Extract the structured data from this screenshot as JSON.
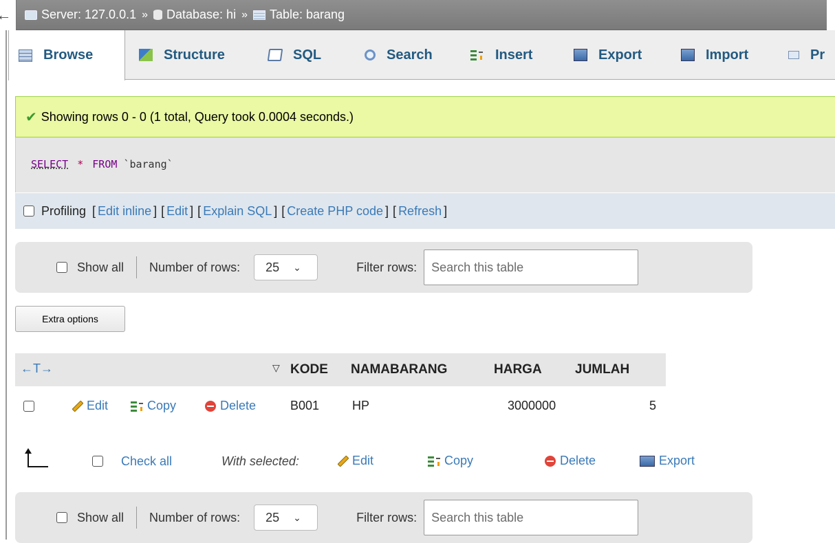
{
  "breadcrumb": {
    "back": "←",
    "server": "Server: 127.0.0.1",
    "sep": "»",
    "database": "Database: hi",
    "table": "Table: barang"
  },
  "tabs": [
    "Browse",
    "Structure",
    "SQL",
    "Search",
    "Insert",
    "Export",
    "Import",
    "Pr"
  ],
  "success": {
    "check": "✔",
    "message": "Showing rows 0 - 0 (1 total, Query took 0.0004 seconds.)"
  },
  "sql": {
    "select": "SELECT",
    "star": "*",
    "from": "FROM",
    "table": "`barang`"
  },
  "profiling": {
    "label": "Profiling",
    "links": [
      "Edit inline",
      "Edit",
      "Explain SQL",
      "Create PHP code",
      "Refresh"
    ],
    "open": "[",
    "close": "]"
  },
  "nav": {
    "show_all": "Show all",
    "num_rows_label": "Number of rows:",
    "num_rows_value": "25",
    "chevron": "⌄",
    "filter_label": "Filter rows:",
    "filter_placeholder": "Search this table"
  },
  "extra_options": "Extra options",
  "table": {
    "controls": "←T→",
    "sort_arrow": "▽",
    "columns": [
      "KODE",
      "NAMABARANG",
      "HARGA",
      "JUMLAH"
    ],
    "row_actions": {
      "edit": "Edit",
      "copy": "Copy",
      "delete": "Delete"
    },
    "rows": [
      {
        "KODE": "B001",
        "NAMABARANG": "HP",
        "HARGA": "3000000",
        "JUMLAH": "5"
      }
    ]
  },
  "bulk": {
    "check_all": "Check all",
    "with_selected": "With selected:",
    "edit": "Edit",
    "copy": "Copy",
    "delete": "Delete",
    "export": "Export"
  }
}
